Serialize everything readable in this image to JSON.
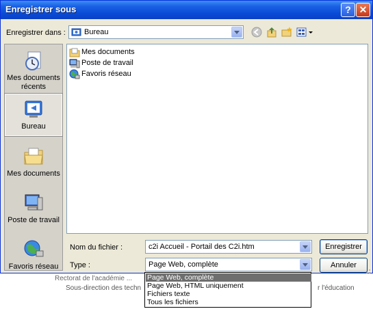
{
  "dialog": {
    "title": "Enregistrer sous",
    "help_glyph": "?",
    "close_glyph": "✕"
  },
  "save_in": {
    "label": "Enregistrer dans :",
    "value": "Bureau"
  },
  "toolbar": {
    "icons": [
      "back-icon",
      "up-folder-icon",
      "new-folder-icon",
      "view-menu-icon"
    ]
  },
  "places": [
    {
      "label": "Mes documents récents",
      "icon": "recent-documents-icon"
    },
    {
      "label": "Bureau",
      "icon": "desktop-icon",
      "selected": true
    },
    {
      "label": "Mes documents",
      "icon": "my-documents-icon"
    },
    {
      "label": "Poste de travail",
      "icon": "my-computer-icon"
    },
    {
      "label": "Favoris réseau",
      "icon": "network-places-icon"
    }
  ],
  "files": [
    {
      "name": "Mes documents",
      "icon": "folder-icon"
    },
    {
      "name": "Poste de travail",
      "icon": "computer-icon"
    },
    {
      "name": "Favoris réseau",
      "icon": "network-icon"
    }
  ],
  "filename": {
    "label": "Nom du fichier :",
    "value": "c2i  Accueil - Portail des C2i.htm"
  },
  "filetype": {
    "label": "Type :",
    "value": "Page Web, complète",
    "options": [
      "Page Web, complète",
      "Page Web, HTML uniquement",
      "Fichiers texte",
      "Tous les fichiers"
    ],
    "selected_index": 0
  },
  "buttons": {
    "save": "Enregistrer",
    "cancel": "Annuler"
  },
  "background_page": {
    "line1": "Rectorat de l'académie ... ",
    "line2": "Sous-direction des techn",
    "line3": "r l'éducation"
  },
  "colors": {
    "titlebar": "#0A4BD6",
    "dialog_bg": "#ECE9D8",
    "selected_option": "#6E6E6E"
  }
}
